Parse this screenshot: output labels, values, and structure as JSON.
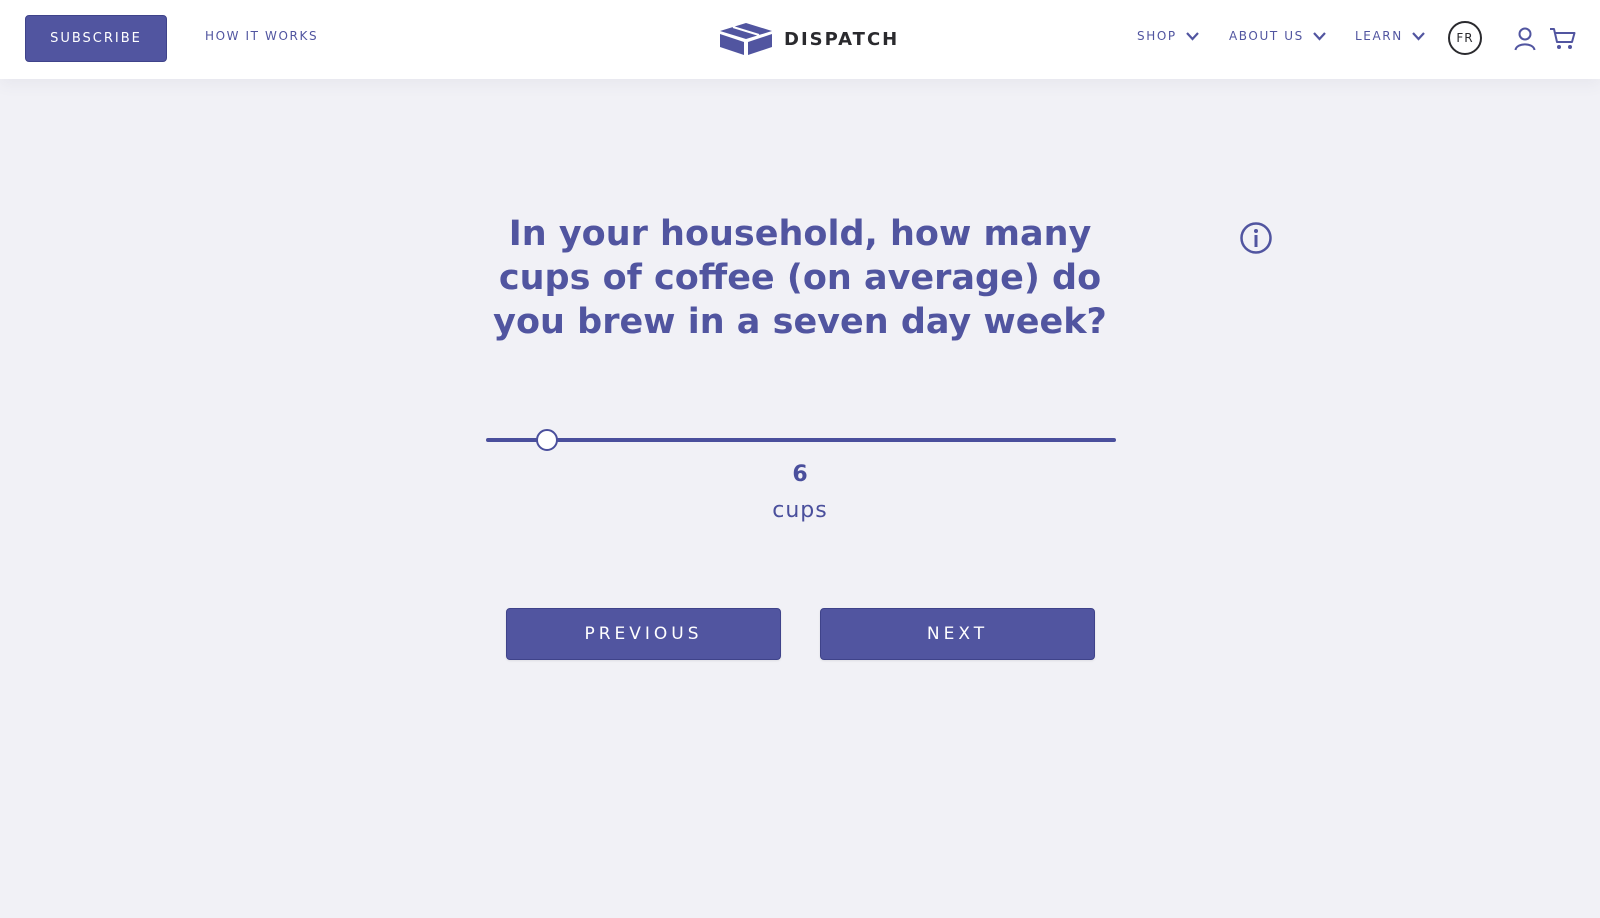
{
  "header": {
    "subscribe_label": "SUBSCRIBE",
    "how_it_works_label": "HOW IT WORKS",
    "logo_text": "DISPATCH",
    "nav": [
      {
        "label": "SHOP"
      },
      {
        "label": "ABOUT US"
      },
      {
        "label": "LEARN"
      }
    ],
    "language": "FR",
    "icons": {
      "account": "user-icon",
      "cart": "cart-icon",
      "chevron": "chevron-down-icon"
    }
  },
  "main": {
    "question": "In your household, how many cups of coffee (on average) do you brew in a seven day week?",
    "info_icon": "info-icon",
    "slider": {
      "value": 6,
      "unit": "cups",
      "position_fraction": 0.097
    },
    "previous_label": "PREVIOUS",
    "next_label": "NEXT"
  },
  "colors": {
    "primary": "#5155a0",
    "background": "#f1f1f6",
    "header_bg": "#ffffff",
    "logo_text": "#2a2a2e"
  }
}
